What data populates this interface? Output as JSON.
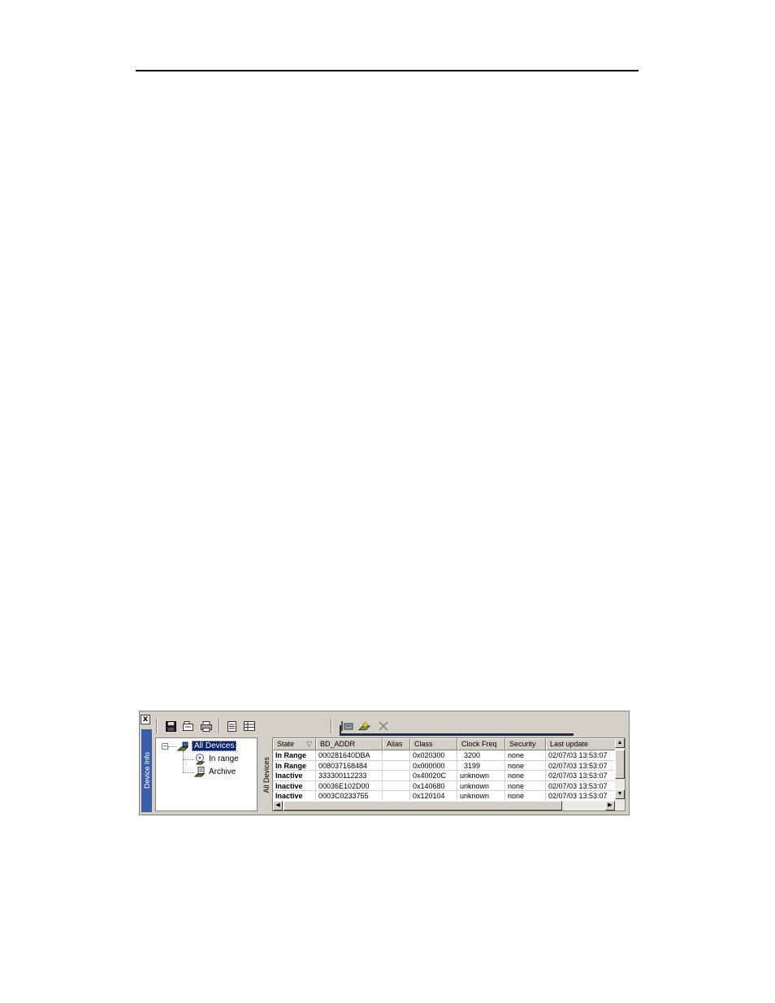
{
  "panel": {
    "close_label": "x",
    "side_caption": "Device Info",
    "pane_caption": "All Devices"
  },
  "toolbar": {
    "icons": [
      "save-icon",
      "open-icon",
      "print-icon",
      "document-icon",
      "table-view-icon",
      "connect-icon",
      "add-device-icon",
      "delete-icon"
    ]
  },
  "tree": {
    "root": "All Devices",
    "children": [
      "In range",
      "Archive"
    ]
  },
  "table": {
    "columns": [
      "State",
      "BD_ADDR",
      "Alias",
      "Class",
      "Clock Freq",
      "Security",
      "Last update"
    ],
    "sort_indicator": "▽",
    "rows": [
      [
        "In Range",
        "000281640DBA",
        "",
        "0x020300",
        "3200",
        "none",
        "02/07/03 13:53:07"
      ],
      [
        "In Range",
        "008037168484",
        "",
        "0x000000",
        "3199",
        "none",
        "02/07/03 13:53:07"
      ],
      [
        "Inactive",
        "333300112233",
        "",
        "0x40020C",
        "unknown",
        "none",
        "02/07/03 13:53:07"
      ],
      [
        "Inactive",
        "00036E102D00",
        "",
        "0x140680",
        "unknown",
        "none",
        "02/07/03 13:53:07"
      ],
      [
        "Inactive",
        "0003C0233755",
        "",
        "0x120104",
        "unknown",
        "none",
        "02/07/03 13:53:07"
      ]
    ]
  }
}
